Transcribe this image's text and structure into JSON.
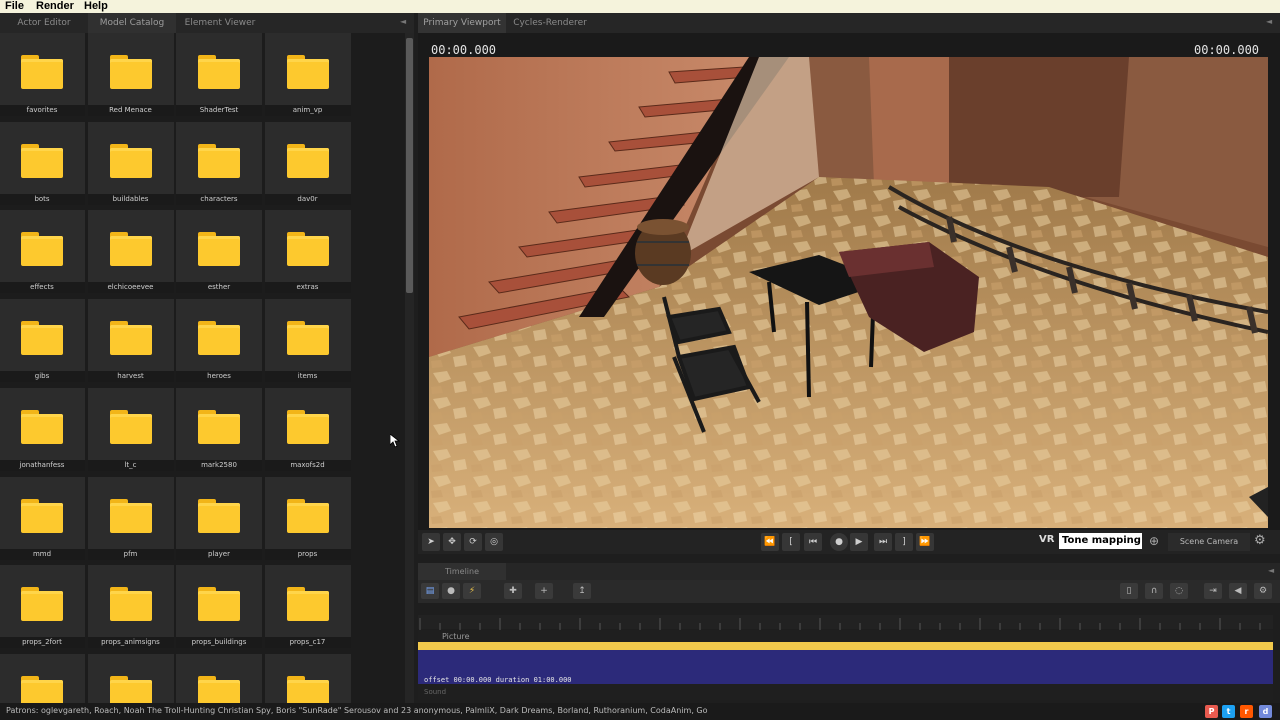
{
  "menu": {
    "items": [
      "File",
      "Render",
      "Help"
    ]
  },
  "left_tabs": [
    "Actor Editor",
    "Model Catalog",
    "Element Viewer"
  ],
  "catalog": {
    "folders": [
      "favorites",
      "Red Menace",
      "ShaderTest",
      "anim_vp",
      "bots",
      "buildables",
      "characters",
      "dav0r",
      "effects",
      "elchicoeevee",
      "esther",
      "extras",
      "gibs",
      "harvest",
      "heroes",
      "items",
      "jonathanfess",
      "lt_c",
      "mark2580",
      "maxofs2d",
      "mmd",
      "pfm",
      "player",
      "props",
      "props_2fort",
      "props_animsigns",
      "props_buildings",
      "props_c17",
      "",
      "",
      "",
      ""
    ]
  },
  "right_tabs": [
    "Primary Viewport",
    "Cycles-Renderer"
  ],
  "viewport": {
    "timecode_left": "00:00.000",
    "timecode_right": "00:00.000"
  },
  "transport": {
    "vr_label": "VR",
    "tone_mapping": "Tone mapping",
    "camera_select": "Scene Camera"
  },
  "timeline": {
    "tab": "Timeline",
    "track_label": "Picture",
    "clip_info": "offset 00:00.000 duration 01:00.000",
    "sound_label": "Sound"
  },
  "status": {
    "patrons": "Patrons: oglevgareth, Roach, Noah The Troll-Hunting Christian Spy, Boris \"SunRade\" Serousov and 23 anonymous, PalmliX, Dark Dreams, Borland, Ruthoranium, CodaAnim, Go"
  },
  "social_icons": [
    "patreon-icon",
    "twitter-icon",
    "reddit-icon",
    "discord-icon"
  ],
  "colors": {
    "folder": "#fdc92e",
    "clip_bar": "#f2c94c",
    "clip_body": "#2c2a7a"
  }
}
